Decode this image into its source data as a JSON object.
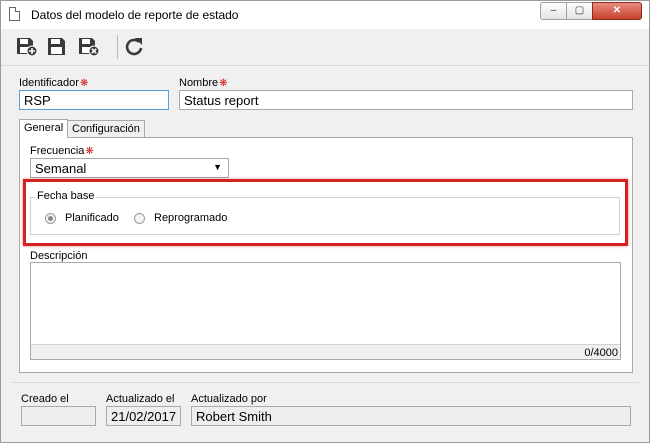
{
  "window": {
    "title": "Datos del modelo de reporte de estado",
    "minimize_glyph": "‒",
    "maximize_glyph": "▢",
    "close_glyph": "✕"
  },
  "toolbar": {
    "buttons": [
      {
        "name": "save-new-icon",
        "label": "save-new"
      },
      {
        "name": "save-icon",
        "label": "save"
      },
      {
        "name": "save-close-icon",
        "label": "save-close"
      },
      {
        "name": "refresh-icon",
        "label": "refresh"
      }
    ]
  },
  "fields": {
    "identificador": {
      "label": "Identificador",
      "value": "RSP"
    },
    "nombre": {
      "label": "Nombre",
      "value": "Status report"
    }
  },
  "required_mark": "❋",
  "tabs": [
    {
      "label": "General",
      "active": true
    },
    {
      "label": "Configuración",
      "active": false
    }
  ],
  "general": {
    "frecuencia": {
      "label": "Frecuencia",
      "value": "Semanal",
      "arrow": "▼"
    },
    "fecha_base": {
      "legend": "Fecha base",
      "options": [
        {
          "label": "Planificado",
          "selected": true
        },
        {
          "label": "Reprogramado",
          "selected": false
        }
      ]
    },
    "descripcion": {
      "label": "Descripción",
      "value": "",
      "counter": "0/4000"
    }
  },
  "footer": {
    "creado_el": {
      "label": "Creado el",
      "value": ""
    },
    "actualizado_el": {
      "label": "Actualizado el",
      "value": "21/02/2017"
    },
    "actualizado_por": {
      "label": "Actualizado por",
      "value": "Robert Smith"
    }
  },
  "colors": {
    "accent_focus": "#5aa0d8",
    "highlight": "#d32222",
    "required": "#d21e1e",
    "close_button": "#c7402d"
  }
}
